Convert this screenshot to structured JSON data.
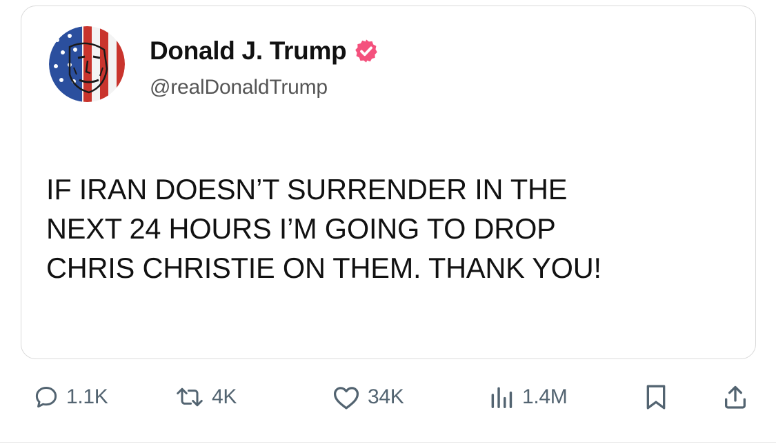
{
  "post": {
    "author": {
      "display_name": "Donald J. Trump",
      "handle": "@realDonaldTrump",
      "verified_icon": "verified-badge-icon",
      "avatar": "flag-face-avatar"
    },
    "text_lines": [
      "IF IRAN DOESN’T SURRENDER IN THE",
      "NEXT 24 HOURS I’M GOING TO DROP",
      "CHRIS CHRISTIE ON THEM. THANK YOU!"
    ]
  },
  "actions": {
    "reply": {
      "icon": "reply-icon",
      "count": "1.1K"
    },
    "repost": {
      "icon": "repost-icon",
      "count": "4K"
    },
    "like": {
      "icon": "heart-icon",
      "count": "34K"
    },
    "views": {
      "icon": "views-chart-icon",
      "count": "1.4M"
    },
    "bookmark": {
      "icon": "bookmark-icon"
    },
    "share": {
      "icon": "share-icon"
    }
  },
  "colors": {
    "text": "#111111",
    "muted": "#536471",
    "badge": "#f4517d",
    "border": "#d9d9d9"
  }
}
